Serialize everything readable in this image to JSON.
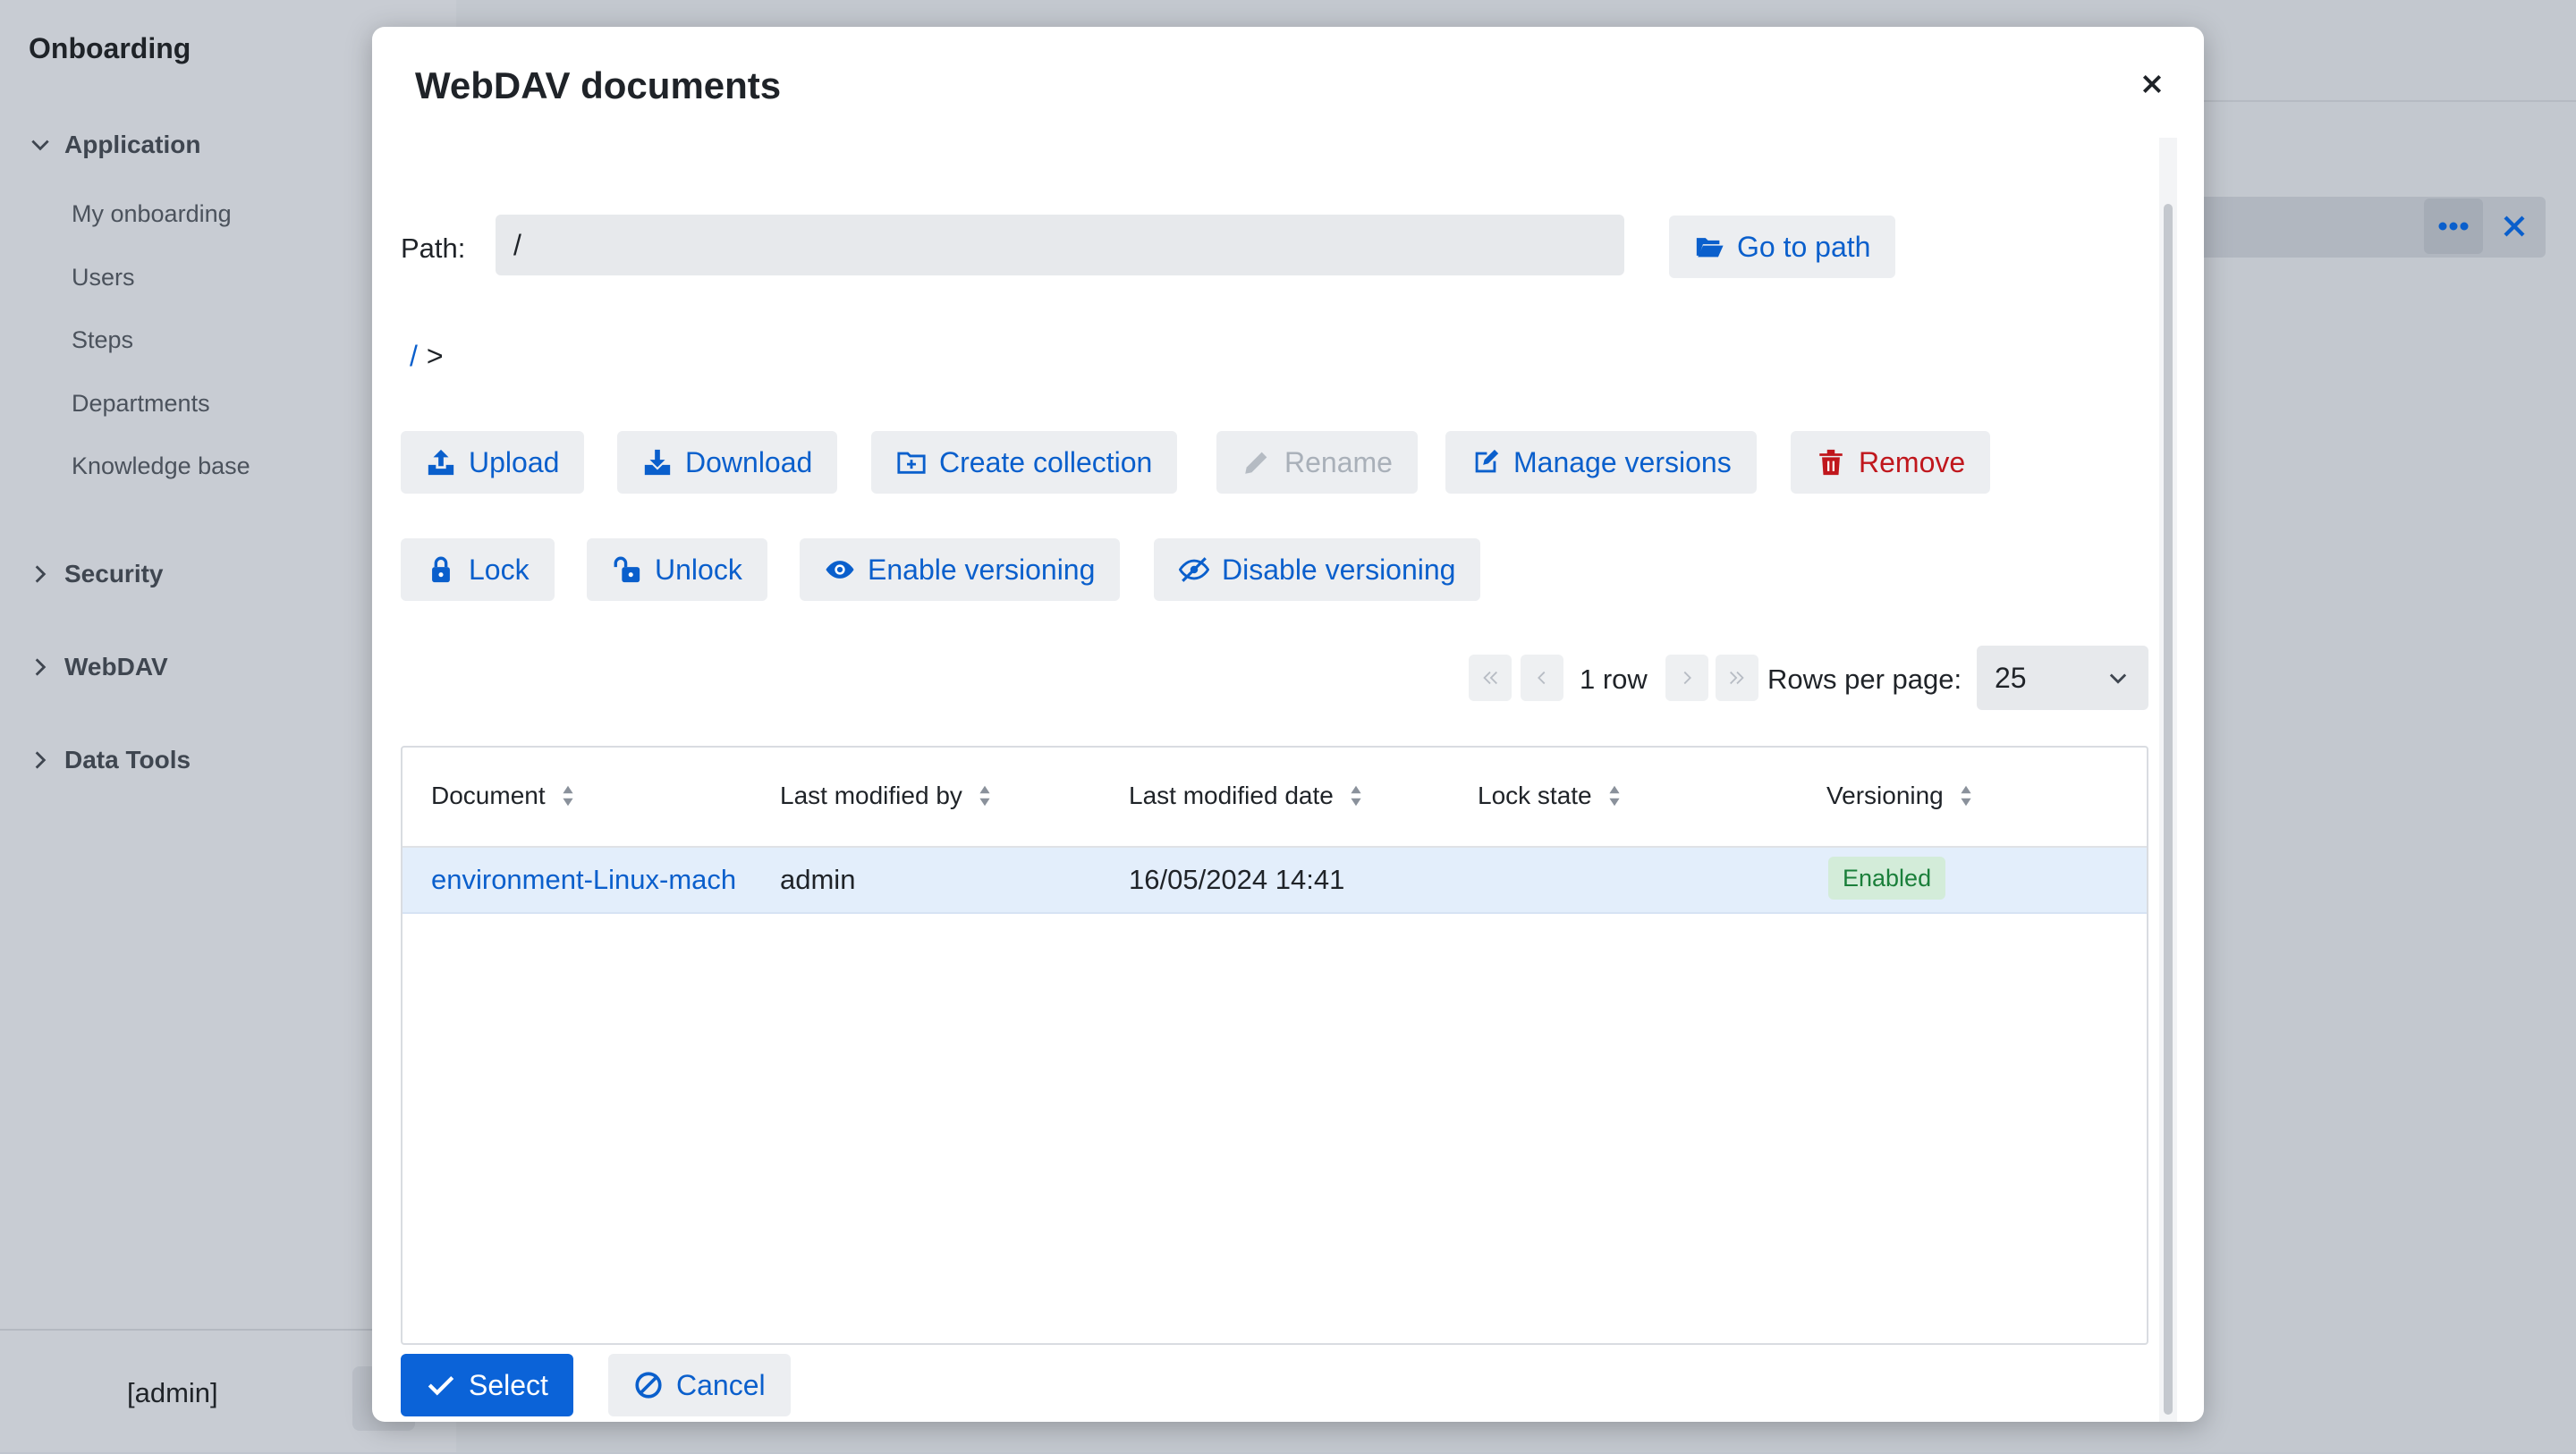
{
  "app": {
    "title": "Onboarding",
    "nav": [
      {
        "label": "Application",
        "expanded": true,
        "items": [
          "My onboarding",
          "Users",
          "Steps",
          "Departments",
          "Knowledge base"
        ]
      },
      {
        "label": "Security",
        "expanded": false
      },
      {
        "label": "WebDAV",
        "expanded": false
      },
      {
        "label": "Data Tools",
        "expanded": false
      }
    ],
    "user": "[admin]"
  },
  "modal": {
    "title": "WebDAV documents",
    "path_label": "Path:",
    "path_value": "/",
    "go_to_path": "Go to path",
    "breadcrumb": {
      "root": "/",
      "separator": ">"
    },
    "toolbar": {
      "upload": "Upload",
      "download": "Download",
      "create_collection": "Create collection",
      "rename": "Rename",
      "manage_versions": "Manage versions",
      "remove": "Remove",
      "lock": "Lock",
      "unlock": "Unlock",
      "enable_versioning": "Enable versioning",
      "disable_versioning": "Disable versioning"
    },
    "pagination": {
      "row_count": "1 row",
      "rows_per_page_label": "Rows per page:",
      "rows_per_page": "25"
    },
    "table": {
      "columns": [
        "Document",
        "Last modified by",
        "Last modified date",
        "Lock state",
        "Versioning"
      ],
      "rows": [
        {
          "document": "environment-Linux-mach",
          "modified_by": "admin",
          "modified_date": "16/05/2024 14:41",
          "lock_state": "",
          "versioning": "Enabled"
        }
      ]
    },
    "footer": {
      "select": "Select",
      "cancel": "Cancel"
    }
  },
  "colors": {
    "accent": "#0b63d8",
    "danger": "#c0171d",
    "success": "#1a7f3a",
    "row_selected": "#e3eefb"
  }
}
